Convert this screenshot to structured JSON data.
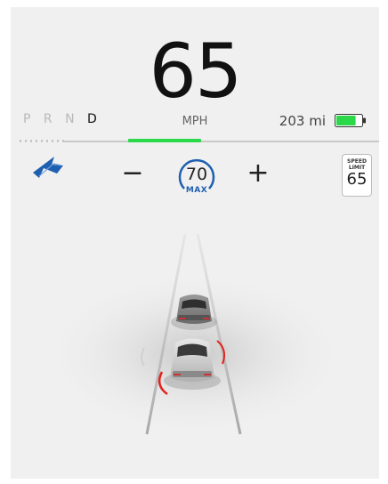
{
  "speed": {
    "value": "65",
    "unit": "MPH"
  },
  "gears": {
    "items": [
      "P",
      "R",
      "N",
      "D"
    ],
    "active": "D"
  },
  "range": {
    "value": "203",
    "unit": "mi"
  },
  "battery": {
    "level": 0.8,
    "color": "#2bd84a"
  },
  "set_speed": {
    "value": "70",
    "label": "MAX",
    "ring_color": "#1f5fb0"
  },
  "controls": {
    "decrease_label": "−",
    "increase_label": "+"
  },
  "speed_limit_sign": {
    "line1": "SPEED",
    "line2": "LIMIT",
    "value": "65"
  },
  "colors": {
    "accent_green": "#2bd84a",
    "autopilot_blue": "#1f5fb0",
    "warning_red": "#e0231c"
  },
  "icons": [
    "autopilot-steering-icon",
    "battery-icon",
    "car-icon"
  ]
}
